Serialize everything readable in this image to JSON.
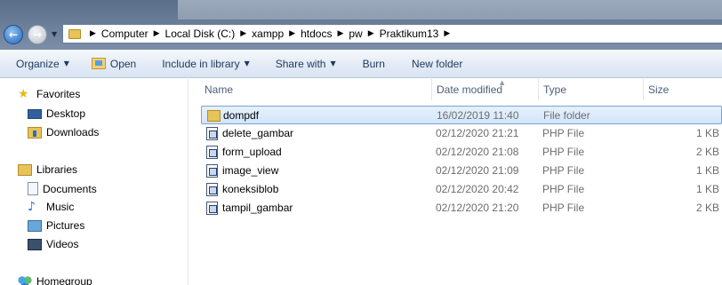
{
  "address_bar": {
    "breadcrumbs": [
      "Computer",
      "Local Disk (C:)",
      "xampp",
      "htdocs",
      "pw",
      "Praktikum13"
    ]
  },
  "toolbar": {
    "organize_label": "Organize",
    "open_label": "Open",
    "include_label": "Include in library",
    "share_label": "Share with",
    "burn_label": "Burn",
    "new_folder_label": "New folder"
  },
  "nav": {
    "favorites": "Favorites",
    "desktop": "Desktop",
    "downloads": "Downloads",
    "libraries": "Libraries",
    "documents": "Documents",
    "music": "Music",
    "pictures": "Pictures",
    "videos": "Videos",
    "homegroup": "Homegroup"
  },
  "columns": {
    "name": "Name",
    "date": "Date modified",
    "type": "Type",
    "size": "Size"
  },
  "files": [
    {
      "name": "dompdf",
      "date": "16/02/2019 11:40",
      "type": "File folder",
      "size": "",
      "icon": "folder-icon",
      "selected": true
    },
    {
      "name": "delete_gambar",
      "date": "02/12/2020 21:21",
      "type": "PHP File",
      "size": "1 KB",
      "icon": "php-file-icon"
    },
    {
      "name": "form_upload",
      "date": "02/12/2020 21:08",
      "type": "PHP File",
      "size": "2 KB",
      "icon": "php-file-icon"
    },
    {
      "name": "image_view",
      "date": "02/12/2020 21:09",
      "type": "PHP File",
      "size": "1 KB",
      "icon": "php-file-icon"
    },
    {
      "name": "koneksiblob",
      "date": "02/12/2020 20:42",
      "type": "PHP File",
      "size": "1 KB",
      "icon": "php-file-icon"
    },
    {
      "name": "tampil_gambar",
      "date": "02/12/2020 21:20",
      "type": "PHP File",
      "size": "2 KB",
      "icon": "php-file-icon"
    }
  ]
}
